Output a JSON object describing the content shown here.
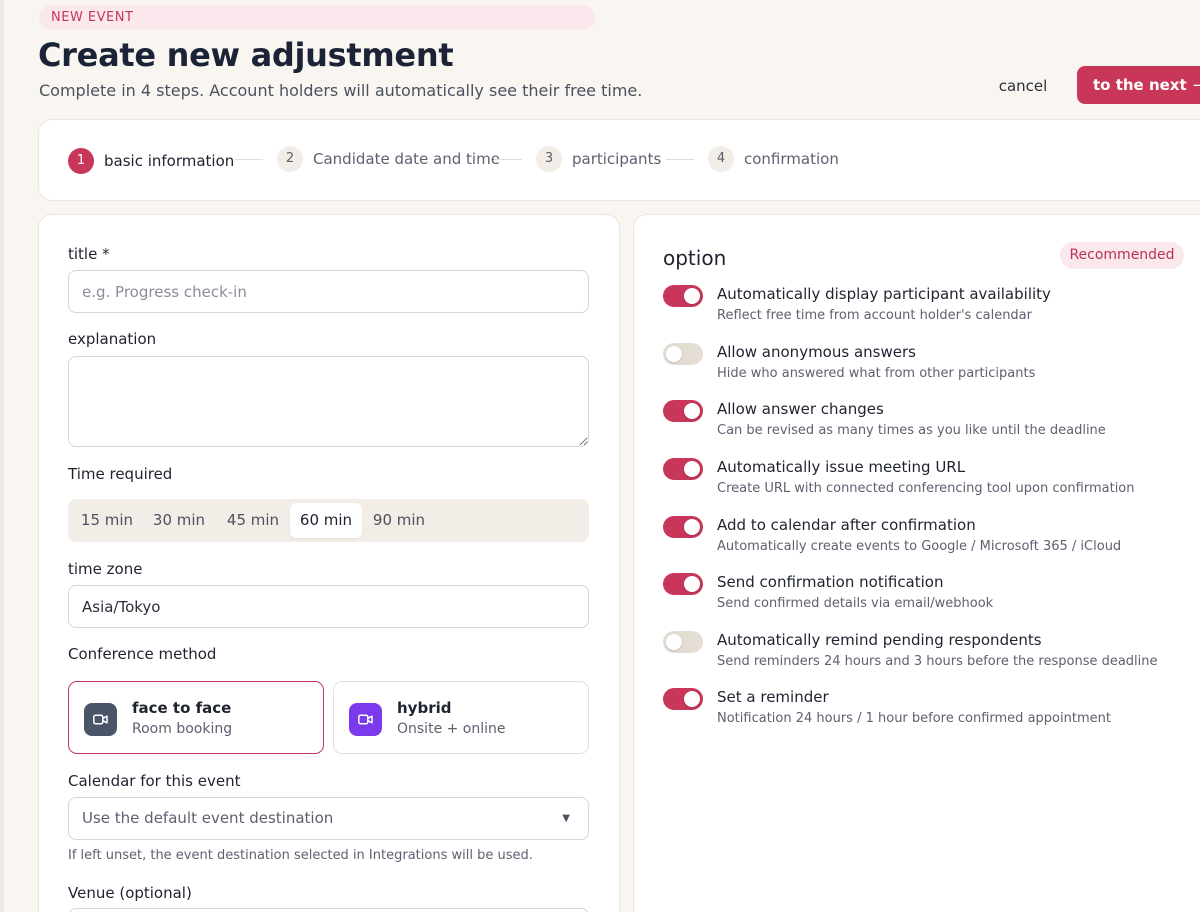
{
  "header": {
    "badge": "NEW EVENT",
    "title": "Create new adjustment",
    "subtitle": "Complete in 4 steps. Account holders will automatically see their free time.",
    "cancel_label": "cancel",
    "next_label": "to the next",
    "next_arrow": "→"
  },
  "steps": [
    {
      "num": "1",
      "label": "basic information",
      "active": true
    },
    {
      "num": "2",
      "label": "Candidate date and time",
      "active": false
    },
    {
      "num": "3",
      "label": "participants",
      "active": false
    },
    {
      "num": "4",
      "label": "confirmation",
      "active": false
    }
  ],
  "form": {
    "title_label": "title *",
    "title_placeholder": "e.g. Progress check-in",
    "title_value": "",
    "explanation_label": "explanation",
    "explanation_value": "",
    "time_label": "Time required",
    "durations": [
      "15 min",
      "30 min",
      "45 min",
      "60 min",
      "90 min"
    ],
    "duration_selected": "60 min",
    "timezone_label": "time zone",
    "timezone_value": "Asia/Tokyo",
    "conference_label": "Conference method",
    "methods": [
      {
        "title": "face to face",
        "sub": "Room booking",
        "icon": "video-icon",
        "color": "#4a5568",
        "selected": true
      },
      {
        "title": "hybrid",
        "sub": "Onsite + online",
        "icon": "video-icon",
        "color": "#7c3aed",
        "selected": false
      }
    ],
    "calendar_label": "Calendar for this event",
    "calendar_value": "Use the default event destination",
    "calendar_caret": "▼",
    "calendar_hint": "If left unset, the event destination selected in Integrations will be used.",
    "venue_label": "Venue (optional)"
  },
  "options": {
    "title": "option",
    "badge": "Recommended",
    "accent": "#c8365a",
    "items": [
      {
        "title": "Automatically display participant availability",
        "sub": "Reflect free time from account holder's calendar",
        "on": true
      },
      {
        "title": "Allow anonymous answers",
        "sub": "Hide who answered what from other participants",
        "on": false
      },
      {
        "title": "Allow answer changes",
        "sub": "Can be revised as many times as you like until the deadline",
        "on": true
      },
      {
        "title": "Automatically issue meeting URL",
        "sub": "Create URL with connected conferencing tool upon confirmation",
        "on": true
      },
      {
        "title": "Add to calendar after confirmation",
        "sub": "Automatically create events to Google / Microsoft 365 / iCloud",
        "on": true
      },
      {
        "title": "Send confirmation notification",
        "sub": "Send confirmed details via email/webhook",
        "on": true
      },
      {
        "title": "Automatically remind pending respondents",
        "sub": "Send reminders 24 hours and 3 hours before the response deadline",
        "on": false
      },
      {
        "title": "Set a reminder",
        "sub": "Notification 24 hours / 1 hour before confirmed appointment",
        "on": true
      }
    ]
  }
}
